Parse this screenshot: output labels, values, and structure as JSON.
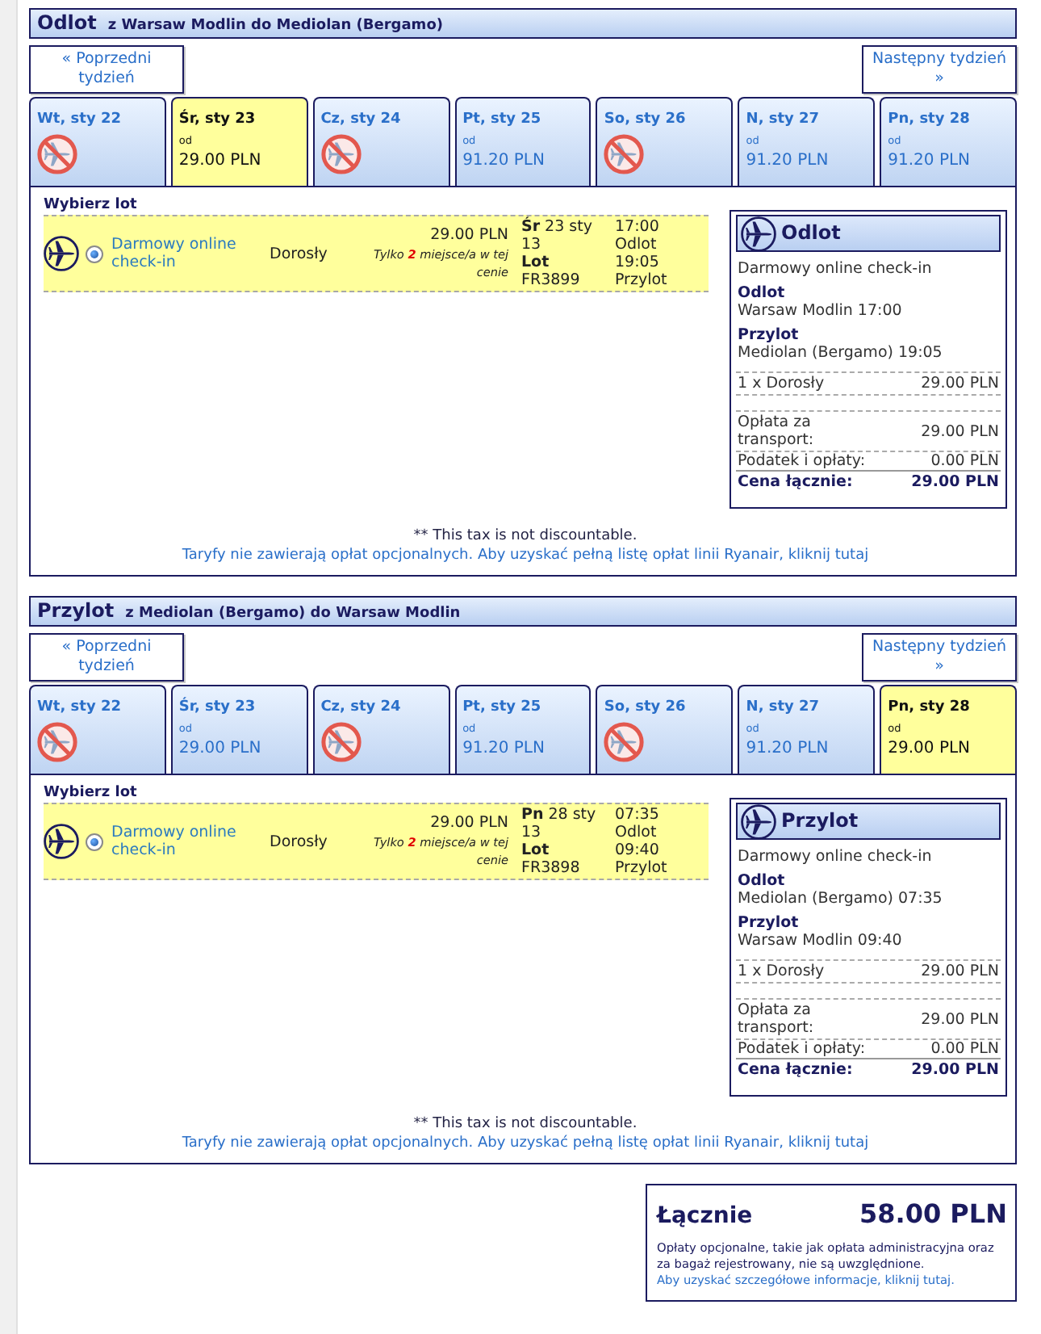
{
  "sections": [
    {
      "title": "Odlot",
      "route": "z Warsaw Modlin do Mediolan (Bergamo)",
      "prev_week": "« Poprzedni tydzień",
      "next_week": "Następny tydzień »",
      "days": [
        {
          "kind": "no_flights",
          "label": "Wt, sty 22",
          "selected": false
        },
        {
          "kind": "fare",
          "label": "Śr, sty 23",
          "from_label": "od",
          "price": "29.00 PLN",
          "selected": true
        },
        {
          "kind": "no_flights",
          "label": "Cz, sty 24",
          "selected": false
        },
        {
          "kind": "fare",
          "label": "Pt, sty 25",
          "from_label": "od",
          "price": "91.20 PLN",
          "selected": false
        },
        {
          "kind": "no_flights",
          "label": "So, sty 26",
          "selected": false
        },
        {
          "kind": "fare",
          "label": "N, sty 27",
          "from_label": "od",
          "price": "91.20 PLN",
          "selected": false
        },
        {
          "kind": "fare",
          "label": "Pn, sty 28",
          "from_label": "od",
          "price": "91.20 PLN",
          "selected": false
        }
      ],
      "choose_label": "Wybierz lot",
      "flight": {
        "selected": true,
        "fare_name": "Darmowy online check-in",
        "passenger": "Dorosły",
        "price": "29.00 PLN",
        "availability": "Tylko **2** miejsce/a w tej cenie",
        "date": "**Śr** 23 sty 13",
        "flight_label": "Lot",
        "flight_number": "FR3899",
        "dep_time": "17:00",
        "dep_label": "Odlot",
        "arr_time": "19:05",
        "arr_label": "Przylot"
      },
      "summary": {
        "title": "Odlot",
        "fare_name": "Darmowy online check-in",
        "departure_label": "Odlot",
        "departure": "Warsaw Modlin 17:00",
        "arrival_label": "Przylot",
        "arrival": "Mediolan (Bergamo) 19:05",
        "rows": [
          {
            "kind": "passenger",
            "label": "1 x Dorosły",
            "value": "29.00 PLN"
          },
          {
            "kind": "transport",
            "label": "Opłata za transport:",
            "value": "29.00 PLN"
          },
          {
            "kind": "tax",
            "label": "Podatek i opłaty:",
            "value": "0.00 PLN"
          },
          {
            "kind": "total",
            "label": "Cena łącznie:",
            "value": "29.00 PLN"
          }
        ]
      },
      "tax_note": "** This tax is not discountable.",
      "fees_link": "Taryfy nie zawierają opłat opcjonalnych. Aby uzyskać pełną listę opłat linii Ryanair, kliknij tutaj"
    },
    {
      "title": "Przylot",
      "route": "z Mediolan (Bergamo) do Warsaw Modlin",
      "prev_week": "« Poprzedni tydzień",
      "next_week": "Następny tydzień »",
      "days": [
        {
          "kind": "no_flights",
          "label": "Wt, sty 22",
          "selected": false
        },
        {
          "kind": "fare",
          "label": "Śr, sty 23",
          "from_label": "od",
          "price": "29.00 PLN",
          "selected": false
        },
        {
          "kind": "no_flights",
          "label": "Cz, sty 24",
          "selected": false
        },
        {
          "kind": "fare",
          "label": "Pt, sty 25",
          "from_label": "od",
          "price": "91.20 PLN",
          "selected": false
        },
        {
          "kind": "no_flights",
          "label": "So, sty 26",
          "selected": false
        },
        {
          "kind": "fare",
          "label": "N, sty 27",
          "from_label": "od",
          "price": "91.20 PLN",
          "selected": false
        },
        {
          "kind": "fare",
          "label": "Pn, sty 28",
          "from_label": "od",
          "price": "29.00 PLN",
          "selected": true
        }
      ],
      "choose_label": "Wybierz lot",
      "flight": {
        "selected": true,
        "fare_name": "Darmowy online check-in",
        "passenger": "Dorosły",
        "price": "29.00 PLN",
        "availability": "Tylko **2** miejsce/a w tej cenie",
        "date": "**Pn** 28 sty 13",
        "flight_label": "Lot",
        "flight_number": "FR3898",
        "dep_time": "07:35",
        "dep_label": "Odlot",
        "arr_time": "09:40",
        "arr_label": "Przylot"
      },
      "summary": {
        "title": "Przylot",
        "fare_name": "Darmowy online check-in",
        "departure_label": "Odlot",
        "departure": "Mediolan (Bergamo) 07:35",
        "arrival_label": "Przylot",
        "arrival": "Warsaw Modlin 09:40",
        "rows": [
          {
            "kind": "passenger",
            "label": "1 x Dorosły",
            "value": "29.00 PLN"
          },
          {
            "kind": "transport",
            "label": "Opłata za transport:",
            "value": "29.00 PLN"
          },
          {
            "kind": "tax",
            "label": "Podatek i opłaty:",
            "value": "0.00 PLN"
          },
          {
            "kind": "total",
            "label": "Cena łącznie:",
            "value": "29.00 PLN"
          }
        ]
      },
      "tax_note": "** This tax is not discountable.",
      "fees_link": "Taryfy nie zawierają opłat opcjonalnych. Aby uzyskać pełną listę opłat linii Ryanair, kliknij tutaj"
    }
  ],
  "total": {
    "label": "Łącznie",
    "value": "58.00 PLN",
    "note": "Opłaty opcjonalne, takie jak opłata administracyjna oraz za bagaż rejestrowany, nie są uwzględnione.",
    "link": "Aby uzyskać szczegółowe informacje, kliknij tutaj."
  }
}
